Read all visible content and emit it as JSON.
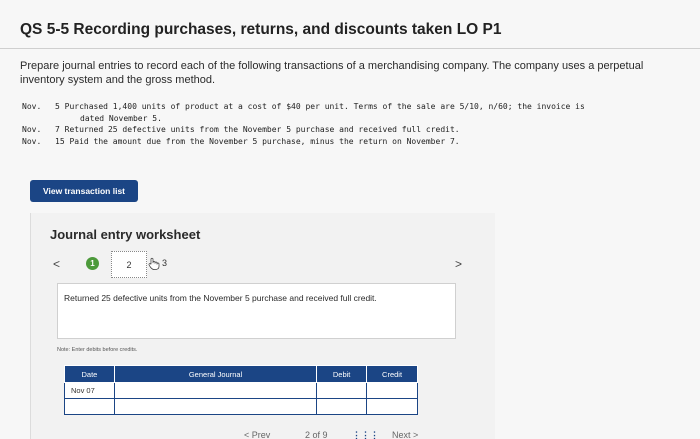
{
  "header": {
    "title": "QS 5-5 Recording purchases, returns, and discounts taken LO P1"
  },
  "instructions": "Prepare journal entries to record each of the following transactions of a merchandising company. The company uses a perpetual inventory system and the gross method.",
  "transactions": [
    {
      "month": "Nov.",
      "text": "5 Purchased 1,400 units of product at a cost of $40 per unit. Terms of the sale are 5/10, n/60; the invoice is",
      "continuation": "dated November 5."
    },
    {
      "month": "Nov.",
      "text": "7 Returned 25 defective units from the November 5 purchase and received full credit."
    },
    {
      "month": "Nov.",
      "text": "15 Paid the amount due from the November 5 purchase, minus the return on November 7."
    }
  ],
  "buttons": {
    "view_transactions": "View transaction list"
  },
  "worksheet": {
    "title": "Journal entry worksheet",
    "nav_prev": "<",
    "nav_next": ">",
    "steps": [
      "1",
      "2",
      "3"
    ],
    "current_step": 2,
    "description": "Returned 25 defective units from the November 5 purchase and received full credit.",
    "note": "Note: Enter debits before credits.",
    "columns": [
      "Date",
      "General Journal",
      "Debit",
      "Credit"
    ],
    "rows": [
      {
        "date": "Nov 07",
        "account": "",
        "debit": "",
        "credit": ""
      },
      {
        "date": "",
        "account": "",
        "debit": "",
        "credit": ""
      }
    ]
  },
  "pager": {
    "prev": "< Prev",
    "info": "2 of 9",
    "grid_icon": "grid-icon",
    "next": "Next >"
  },
  "colors": {
    "primary": "#1b4585",
    "step_done": "#4d9a3b"
  }
}
